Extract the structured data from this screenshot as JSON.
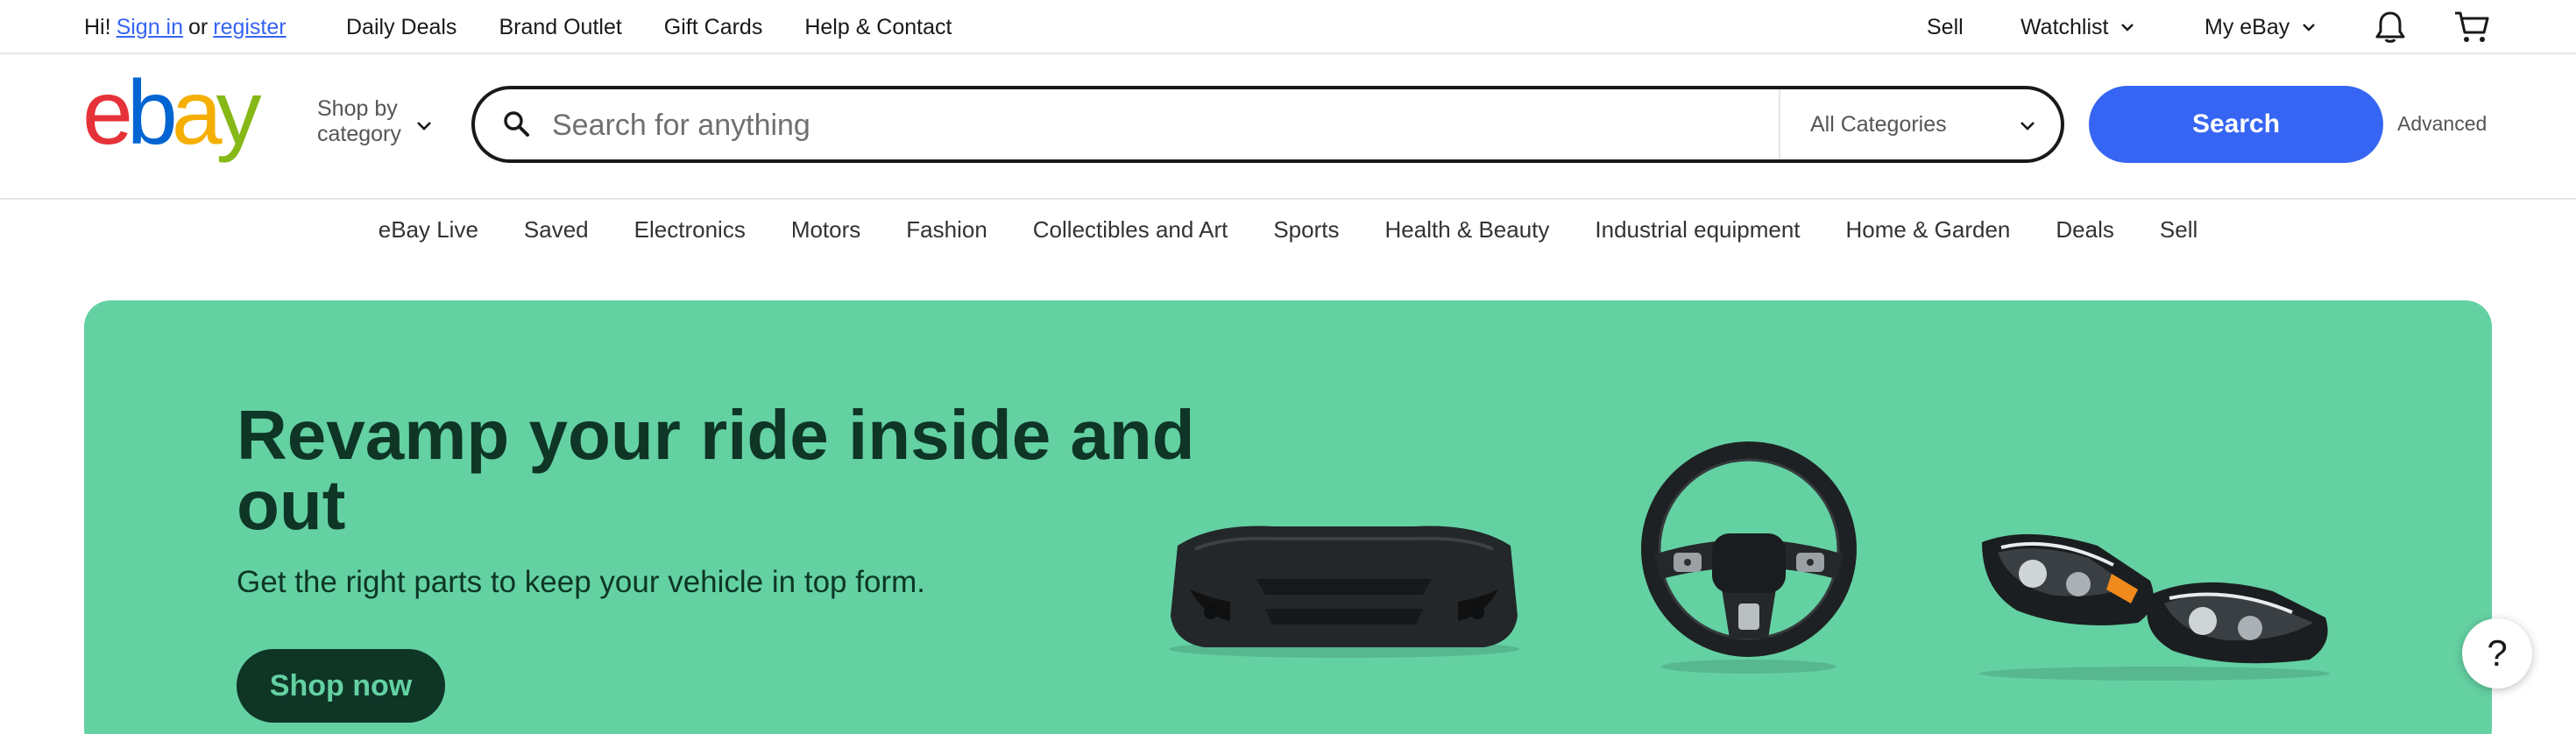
{
  "topbar": {
    "greeting": "Hi!",
    "sign_in": "Sign in",
    "or": "or",
    "register": "register",
    "links": [
      "Daily Deals",
      "Brand Outlet",
      "Gift Cards",
      "Help & Contact"
    ],
    "sell": "Sell",
    "watchlist": "Watchlist",
    "my_ebay": "My eBay"
  },
  "header": {
    "logo_text": "ebay",
    "shop_by_line1": "Shop by",
    "shop_by_line2": "category",
    "search_placeholder": "Search for anything",
    "category_selected": "All Categories",
    "search_button": "Search",
    "advanced": "Advanced"
  },
  "catnav": {
    "items": [
      "eBay Live",
      "Saved",
      "Electronics",
      "Motors",
      "Fashion",
      "Collectibles and Art",
      "Sports",
      "Health & Beauty",
      "Industrial equipment",
      "Home & Garden",
      "Deals",
      "Sell"
    ]
  },
  "hero": {
    "title": "Revamp your ride inside and out",
    "subtitle": "Get the right parts to keep your vehicle in top form.",
    "cta": "Shop now",
    "background": "#64d1a2"
  },
  "help": {
    "label": "?"
  },
  "colors": {
    "accent": "#3665f3",
    "logo_red": "#e53238",
    "logo_blue": "#0064d2",
    "logo_yellow": "#f5af02",
    "logo_green": "#86b817"
  }
}
